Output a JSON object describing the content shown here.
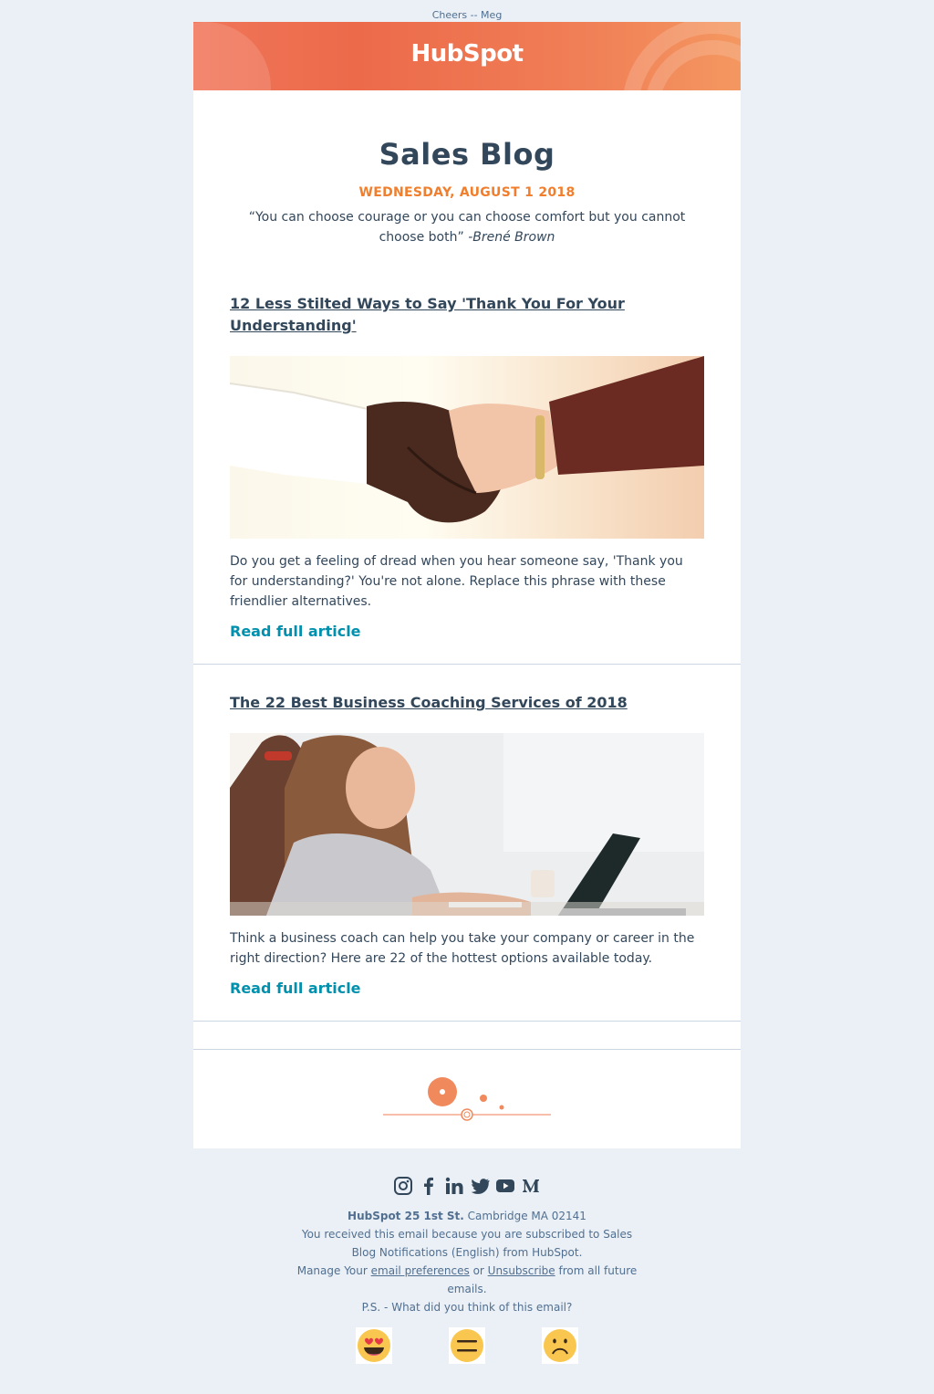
{
  "preheader": "Cheers -- Meg",
  "brand": {
    "logo_text": "HubSpot",
    "accent": "#f07e2c",
    "link_color": "#0091ae"
  },
  "header": {
    "title": "Sales Blog",
    "date": "WEDNESDAY, AUGUST 1 2018",
    "quote": "“You can choose courage or you can choose comfort but you cannot choose both”",
    "quote_author": "-Brené Brown"
  },
  "articles": [
    {
      "title": "12 Less Stilted Ways to Say 'Thank You For Your Understanding'",
      "image": "handshake-photo",
      "summary": "Do you get a feeling of dread when you hear someone say, 'Thank you for understanding?' You're not alone. Replace this phrase with these friendlier alternatives.",
      "cta": "Read full article"
    },
    {
      "title": "The 22 Best Business Coaching Services of 2018",
      "image": "coaching-photo",
      "summary": "Think a business coach can help you take your company or career in the right direction? Here are 22 of the hottest options available today.",
      "cta": "Read full article"
    }
  ],
  "footer": {
    "social_icons": [
      "instagram-icon",
      "facebook-icon",
      "linkedin-icon",
      "twitter-icon",
      "youtube-icon",
      "medium-icon"
    ],
    "company": "HubSpot 25 1st St.",
    "city": "Cambridge MA 02141",
    "subscribed_text": "You received this email because you are subscribed to Sales Blog Notifications (English) from HubSpot.",
    "manage_prefix": "Manage Your",
    "preferences_link": "email preferences",
    "or": "or",
    "unsubscribe_link": "Unsubscribe",
    "manage_suffix": "from all future emails.",
    "ps": "P.S. - What did you think of this email?",
    "feedback": [
      "heart-eyes-emoji",
      "neutral-face-emoji",
      "frowning-face-emoji"
    ]
  }
}
